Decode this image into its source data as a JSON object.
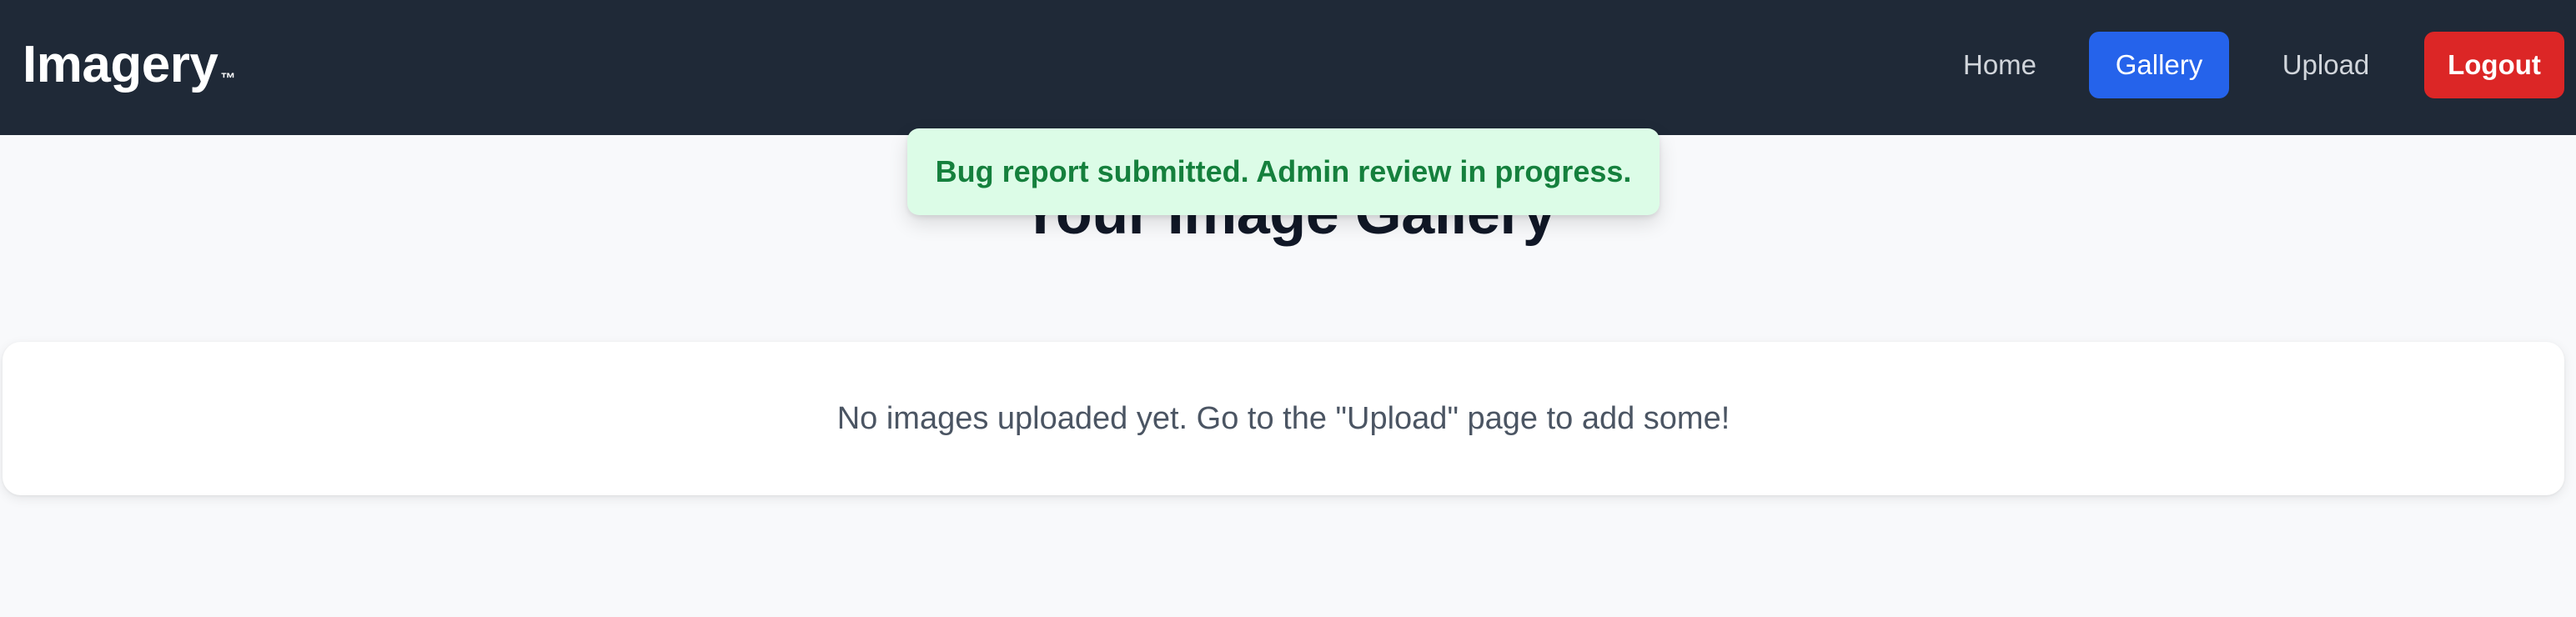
{
  "navbar": {
    "brand": "Imagery",
    "brand_mark": "™",
    "links": {
      "home": "Home",
      "gallery": "Gallery",
      "upload": "Upload",
      "logout": "Logout"
    }
  },
  "main": {
    "title": "Your Image Gallery",
    "empty_message": "No images uploaded yet. Go to the \"Upload\" page to add some!"
  },
  "toast": {
    "message": "Bug report submitted. Admin review in progress."
  },
  "colors": {
    "navbar_bg": "#1f2937",
    "active_tab": "#2563eb",
    "logout": "#dc2626",
    "toast_bg": "#dcfce7",
    "toast_text": "#15803d"
  }
}
